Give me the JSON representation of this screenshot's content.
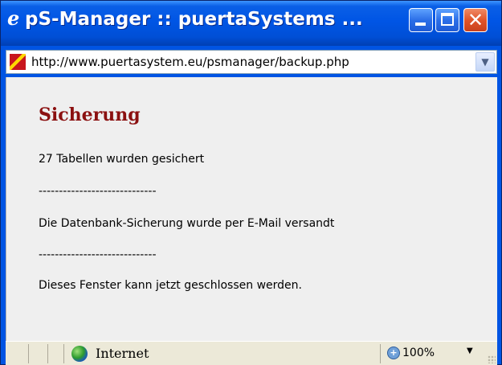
{
  "window": {
    "title": "pS-Manager :: puertaSystems ...",
    "icon": "ie-logo-icon",
    "close_glyph": "✕"
  },
  "address_bar": {
    "url": "http://www.puertasystem.eu/psmanager/backup.php",
    "page_icon": "site-favicon-icon"
  },
  "page": {
    "heading": "Sicherung",
    "lines": [
      "27 Tabellen wurden gesichert",
      "-----------------------------",
      "Die Datenbank-Sicherung wurde per E-Mail versandt",
      "-----------------------------",
      "Dieses Fenster kann jetzt geschlossen werden."
    ]
  },
  "status_bar": {
    "zone": "Internet",
    "zoom": "100%"
  },
  "colors": {
    "titlebar": "#0055e5",
    "heading": "#8b1010",
    "content_bg": "#efefef",
    "statusbar_bg": "#ece9d8"
  }
}
